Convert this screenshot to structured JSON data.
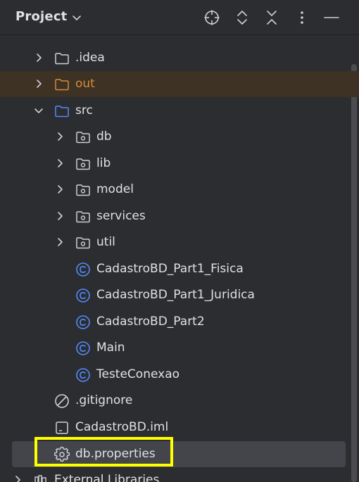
{
  "header": {
    "title": "Project",
    "chevron_icon": "chevron-down-icon",
    "actions": [
      {
        "name": "locate-icon"
      },
      {
        "name": "expand-all-icon"
      },
      {
        "name": "collapse-all-icon"
      },
      {
        "name": "more-options-icon"
      },
      {
        "name": "minimize-icon"
      }
    ]
  },
  "tree": {
    "items": [
      {
        "label": ".idea",
        "icon": "folder-icon",
        "expanded": false
      },
      {
        "label": "out",
        "icon": "folder-excluded-icon",
        "expanded": false,
        "color": "#d38b3c"
      },
      {
        "label": "src",
        "icon": "source-folder-icon",
        "expanded": true
      },
      {
        "label": "db",
        "icon": "package-icon",
        "expanded": false
      },
      {
        "label": "lib",
        "icon": "package-icon",
        "expanded": false
      },
      {
        "label": "model",
        "icon": "package-icon",
        "expanded": false
      },
      {
        "label": "services",
        "icon": "package-icon",
        "expanded": false
      },
      {
        "label": "util",
        "icon": "package-icon",
        "expanded": false
      },
      {
        "label": "CadastroBD_Part1_Fisica",
        "icon": "java-class-icon"
      },
      {
        "label": "CadastroBD_Part1_Juridica",
        "icon": "java-class-icon"
      },
      {
        "label": "CadastroBD_Part2",
        "icon": "java-class-icon"
      },
      {
        "label": "Main",
        "icon": "java-class-icon"
      },
      {
        "label": "TesteConexao",
        "icon": "java-class-icon"
      },
      {
        "label": ".gitignore",
        "icon": "ignore-file-icon"
      },
      {
        "label": "CadastroBD.iml",
        "icon": "module-file-icon"
      },
      {
        "label": "db.properties",
        "icon": "properties-file-icon",
        "selected": true
      },
      {
        "label": "External Libraries",
        "icon": "libraries-icon",
        "expanded": false
      }
    ]
  },
  "colors": {
    "background": "#2b2d30",
    "text": "#dfe1e5",
    "excluded": "#d38b3c",
    "class_icon": "#548af7",
    "highlight_row": "#3d3223",
    "selected_row": "#43454a",
    "annotation": "#ffff00"
  }
}
